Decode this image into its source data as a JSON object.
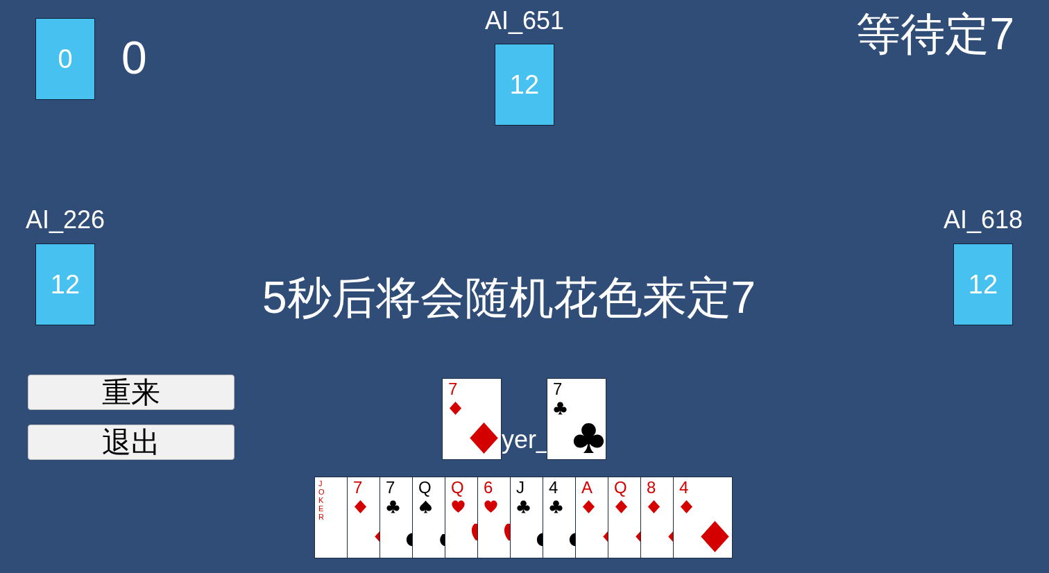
{
  "my_card": {
    "count": "0"
  },
  "score": "0",
  "status": "等待定7",
  "opponents": [
    {
      "kind": "top",
      "name": "AI_651",
      "count": "12"
    },
    {
      "kind": "left",
      "name": "AI_226",
      "count": "12"
    },
    {
      "kind": "right",
      "name": "AI_618",
      "count": "12"
    }
  ],
  "message": "5秒后将会随机花色来定7",
  "buttons": [
    "重来",
    "退出"
  ],
  "played_label": "yer_",
  "played_cards": [
    {
      "kind": "diamond",
      "rank": "7"
    },
    {
      "kind": "club",
      "rank": "7"
    }
  ],
  "hand": [
    {
      "kind": "joker",
      "rank": "JOKER"
    },
    {
      "kind": "diamond",
      "rank": "7"
    },
    {
      "kind": "club",
      "rank": "7"
    },
    {
      "kind": "spade",
      "rank": "Q"
    },
    {
      "kind": "heart",
      "rank": "Q"
    },
    {
      "kind": "heart",
      "rank": "6"
    },
    {
      "kind": "club",
      "rank": "J"
    },
    {
      "kind": "club",
      "rank": "4"
    },
    {
      "kind": "diamond",
      "rank": "A"
    },
    {
      "kind": "diamond",
      "rank": "Q"
    },
    {
      "kind": "diamond",
      "rank": "8"
    },
    {
      "kind": "diamond",
      "rank": "4"
    }
  ]
}
